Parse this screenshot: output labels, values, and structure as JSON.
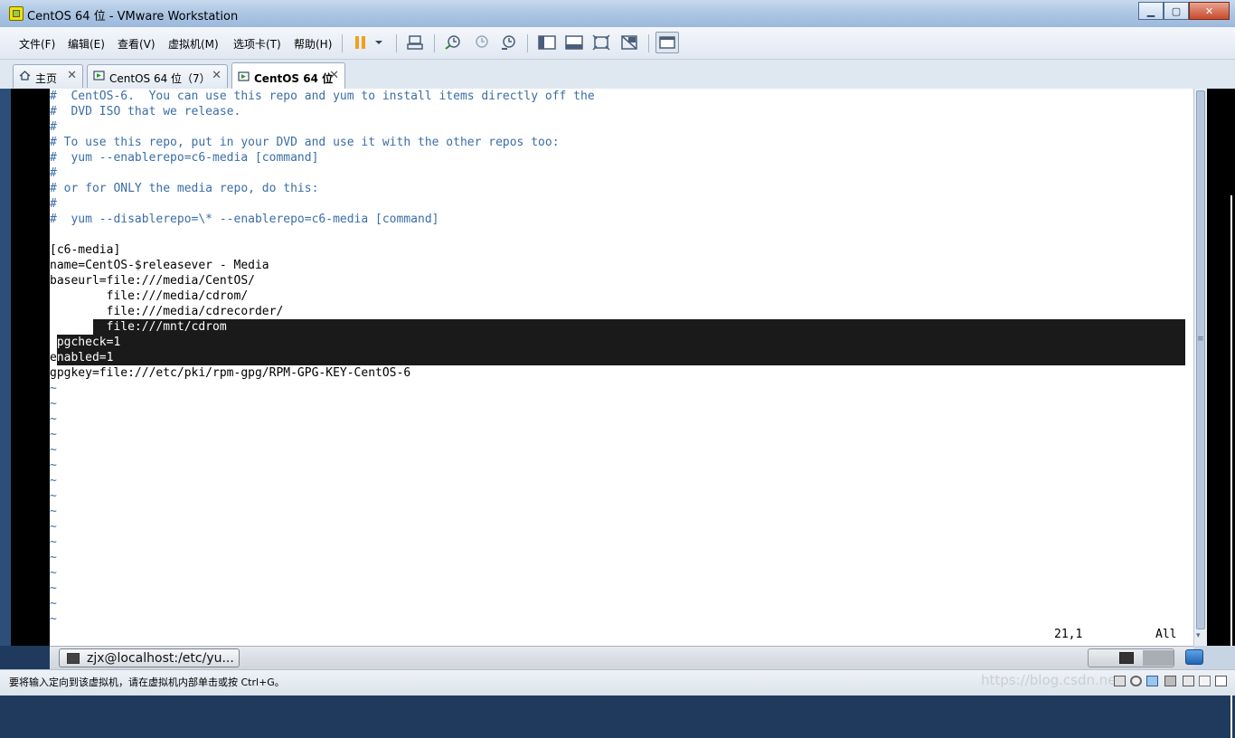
{
  "window": {
    "title": "CentOS 64 位 - VMware Workstation"
  },
  "menu": [
    "文件(F)",
    "编辑(E)",
    "查看(V)",
    "虚拟机(M)",
    "选项卡(T)",
    "帮助(H)"
  ],
  "tabs": [
    {
      "label": "主页"
    },
    {
      "label": "CentOS 64 位（7）"
    },
    {
      "label": "CentOS 64 位"
    }
  ],
  "terminal": {
    "lines": [
      {
        "text": "#  CentOS-6.  You can use this repo and yum to install items directly off the",
        "kind": "comment"
      },
      {
        "text": "#  DVD ISO that we release.",
        "kind": "comment"
      },
      {
        "text": "#",
        "kind": "comment"
      },
      {
        "text": "# To use this repo, put in your DVD and use it with the other repos too:",
        "kind": "comment"
      },
      {
        "text": "#  yum --enablerepo=c6-media [command]",
        "kind": "comment"
      },
      {
        "text": "#",
        "kind": "comment"
      },
      {
        "text": "# or for ONLY the media repo, do this:",
        "kind": "comment"
      },
      {
        "text": "#",
        "kind": "comment"
      },
      {
        "text": "#  yum --disablerepo=\\* --enablerepo=c6-media [command]",
        "kind": "comment"
      },
      {
        "text": "",
        "kind": "plain"
      },
      {
        "text": "[c6-media]",
        "kind": "plain"
      },
      {
        "text": "name=CentOS-$releasever - Media",
        "kind": "plain"
      },
      {
        "text": "baseurl=file:///media/CentOS/",
        "kind": "plain"
      },
      {
        "text": "        file:///media/cdrom/",
        "kind": "plain"
      },
      {
        "text": "        file:///media/cdrecorder/",
        "kind": "plain"
      },
      {
        "text": "        file:///mnt/cdrom",
        "kind": "selected"
      },
      {
        "text": "gpgcheck=1",
        "kind": "selected"
      },
      {
        "text": "enabled=1",
        "kind": "selected"
      },
      {
        "text": "gpgkey=file:///etc/pki/rpm-gpg/RPM-GPG-KEY-CentOS-6",
        "kind": "plain"
      }
    ],
    "tilde_char": "~",
    "tilde_count": 16,
    "cursor_position": "21,1",
    "view_scope": "All"
  },
  "guest_taskbar": {
    "task_label": "zjx@localhost:/etc/yu..."
  },
  "statusbar": {
    "message": "要将输入定向到该虚拟机，请在虚拟机内部单击或按 Ctrl+G。",
    "watermark": "https://blog.csdn.ne"
  },
  "colors": {
    "comment": "#3a6da8",
    "selection": "#1a1a1a",
    "titlebar": "#aec7e4"
  }
}
